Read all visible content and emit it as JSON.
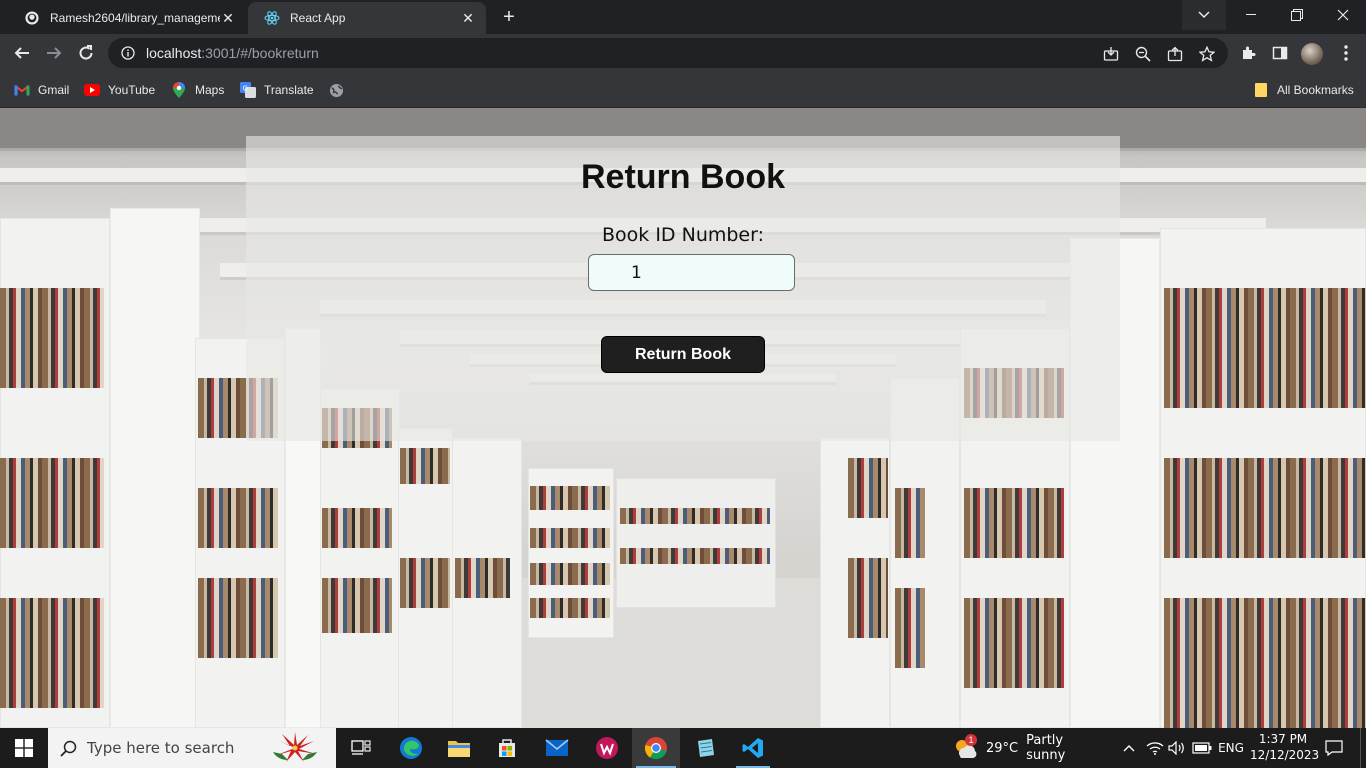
{
  "browser": {
    "tabs": [
      {
        "title": "Ramesh2604/library_manageme",
        "favicon": "github-icon",
        "active": false
      },
      {
        "title": "React App",
        "favicon": "react-icon",
        "active": true
      }
    ],
    "new_tab_label": "+",
    "url_host": "localhost",
    "url_rest": ":3001/#/bookreturn",
    "bookmarks": [
      {
        "label": "Gmail",
        "icon": "gmail-icon"
      },
      {
        "label": "YouTube",
        "icon": "youtube-icon"
      },
      {
        "label": "Maps",
        "icon": "maps-icon"
      },
      {
        "label": "Translate",
        "icon": "translate-icon"
      }
    ],
    "all_bookmarks_label": "All Bookmarks"
  },
  "page": {
    "heading": "Return Book",
    "field_label": "Book ID Number:",
    "book_id_value": "1",
    "submit_label": "Return Book"
  },
  "taskbar": {
    "search_placeholder": "Type here to search",
    "weather_temp": "29°C",
    "weather_desc": "Partly sunny",
    "language": "ENG",
    "time": "1:37 PM",
    "date": "12/12/2023",
    "weather_badge": "1"
  },
  "colors": {
    "browser_frame": "#202124",
    "toolbar": "#35363a",
    "card_overlay": "rgba(230,230,228,0.62)",
    "input_bg": "#f0fcfc",
    "button_bg": "#1f1f1f",
    "taskbar": "#1c1c1c"
  }
}
